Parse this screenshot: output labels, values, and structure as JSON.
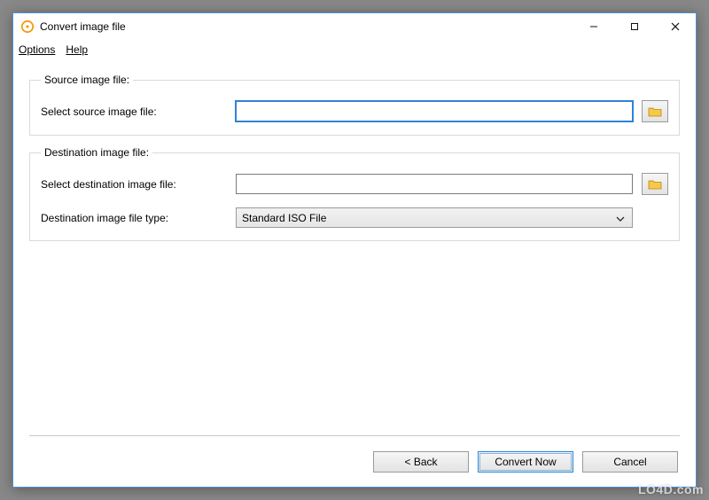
{
  "window": {
    "title": "Convert image file"
  },
  "menubar": {
    "options": "Options",
    "help": "Help"
  },
  "source_group": {
    "legend": "Source image file:",
    "select_label": "Select source image file:",
    "value": ""
  },
  "dest_group": {
    "legend": "Destination image file:",
    "select_label": "Select destination image file:",
    "value": "",
    "type_label": "Destination image file type:",
    "type_value": "Standard ISO File"
  },
  "buttons": {
    "back": "< Back",
    "convert": "Convert Now",
    "cancel": "Cancel"
  },
  "watermark": "LO4D.com"
}
